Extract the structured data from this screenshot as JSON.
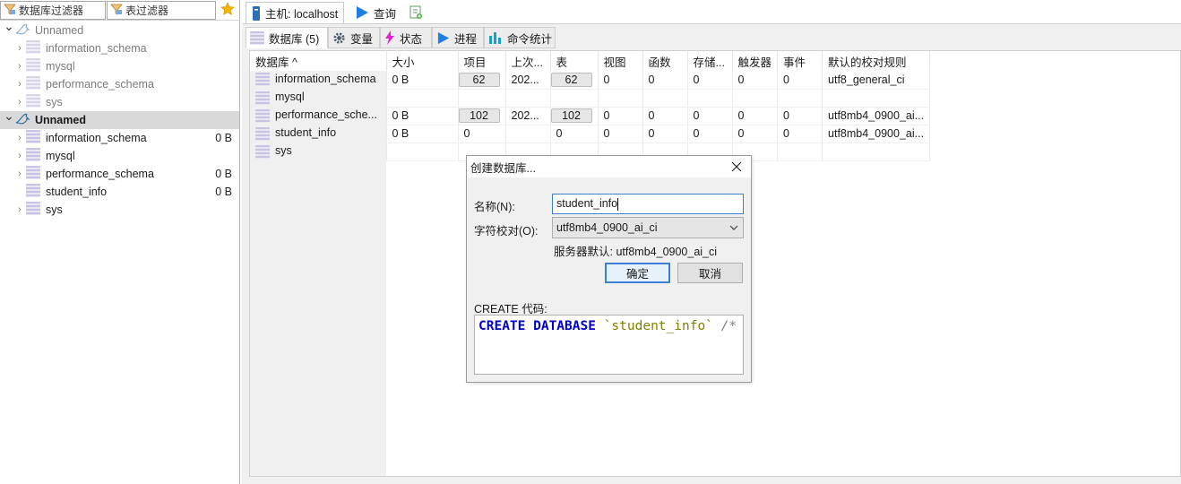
{
  "filters": {
    "db_filter_placeholder": "数据库过滤器",
    "table_filter_placeholder": "表过滤器"
  },
  "tree": [
    {
      "label": "Unnamed",
      "level": 0,
      "expanded": true,
      "muted": true,
      "size": ""
    },
    {
      "label": "information_schema",
      "level": 1,
      "muted": true,
      "size": ""
    },
    {
      "label": "mysql",
      "level": 1,
      "muted": true,
      "size": ""
    },
    {
      "label": "performance_schema",
      "level": 1,
      "muted": true,
      "size": ""
    },
    {
      "label": "sys",
      "level": 1,
      "muted": true,
      "size": ""
    },
    {
      "label": "Unnamed",
      "level": 0,
      "expanded": true,
      "selected": true,
      "bold": true,
      "size": ""
    },
    {
      "label": "information_schema",
      "level": 1,
      "size": "0 B"
    },
    {
      "label": "mysql",
      "level": 1,
      "size": ""
    },
    {
      "label": "performance_schema",
      "level": 1,
      "size": "0 B"
    },
    {
      "label": "student_info",
      "level": 1,
      "size": "0 B",
      "no_arrow": true
    },
    {
      "label": "sys",
      "level": 1,
      "size": ""
    }
  ],
  "top_tabs": {
    "host": "主机: localhost",
    "query": "查询"
  },
  "sub_tabs": {
    "databases": "数据库 (5)",
    "variables": "变量",
    "status": "状态",
    "processes": "进程",
    "command_stats": "命令统计"
  },
  "grid": {
    "columns": [
      "数据库 ^",
      "大小",
      "项目",
      "上次...",
      "表",
      "视图",
      "函数",
      "存储...",
      "触发器",
      "事件",
      "默认的校对规则"
    ],
    "rows": [
      [
        "information_schema",
        "0 B",
        "62",
        "202...",
        "62",
        "0",
        "0",
        "0",
        "0",
        "0",
        "utf8_general_ci"
      ],
      [
        "mysql",
        "",
        "",
        "",
        "",
        "",
        "",
        "",
        "",
        "",
        ""
      ],
      [
        "performance_sche...",
        "0 B",
        "102",
        "202...",
        "102",
        "0",
        "0",
        "0",
        "0",
        "0",
        "utf8mb4_0900_ai..."
      ],
      [
        "student_info",
        "0 B",
        "0",
        "",
        "0",
        "0",
        "0",
        "0",
        "0",
        "0",
        "utf8mb4_0900_ai..."
      ],
      [
        "sys",
        "",
        "",
        "",
        "",
        "",
        "",
        "",
        "",
        "",
        ""
      ]
    ]
  },
  "dialog": {
    "title": "创建数据库...",
    "name_label": "名称(N):",
    "name_value": "student_info",
    "collation_label": "字符校对(O):",
    "collation_value": "utf8mb4_0900_ai_ci",
    "server_default": "服务器默认: utf8mb4_0900_ai_ci",
    "ok": "确定",
    "cancel": "取消",
    "code_label": "CREATE 代码:",
    "code_keyword": "CREATE DATABASE",
    "code_name": "`student_info`",
    "code_comment": "/*"
  },
  "colors": {
    "accent": "#3c7fd4",
    "keyword": "#0000cc",
    "string": "#808000"
  }
}
